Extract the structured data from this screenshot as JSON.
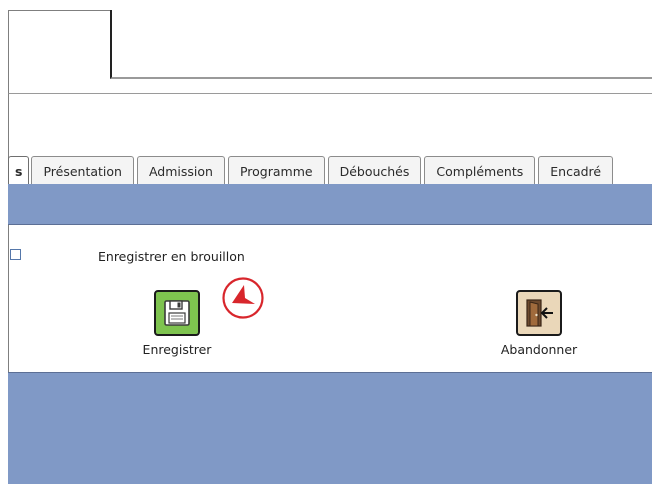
{
  "tabs": [
    {
      "label": "s",
      "active": true
    },
    {
      "label": "Présentation",
      "active": false
    },
    {
      "label": "Admission",
      "active": false
    },
    {
      "label": "Programme",
      "active": false
    },
    {
      "label": "Débouchés",
      "active": false
    },
    {
      "label": "Compléments",
      "active": false
    },
    {
      "label": "Encadré",
      "active": false
    }
  ],
  "form": {
    "draft_checkbox_label": "Enregistrer en brouillon",
    "draft_checked": false
  },
  "actions": {
    "save_label": "Enregistrer",
    "save_icon": "floppy-disk-icon",
    "abandon_label": "Abandonner",
    "abandon_icon": "exit-door-icon"
  },
  "colors": {
    "band": "#8099c6",
    "save_icon_bg": "#7ec34f",
    "abandon_icon_bg": "#ead7b9",
    "cursor_red": "#d8262c"
  }
}
